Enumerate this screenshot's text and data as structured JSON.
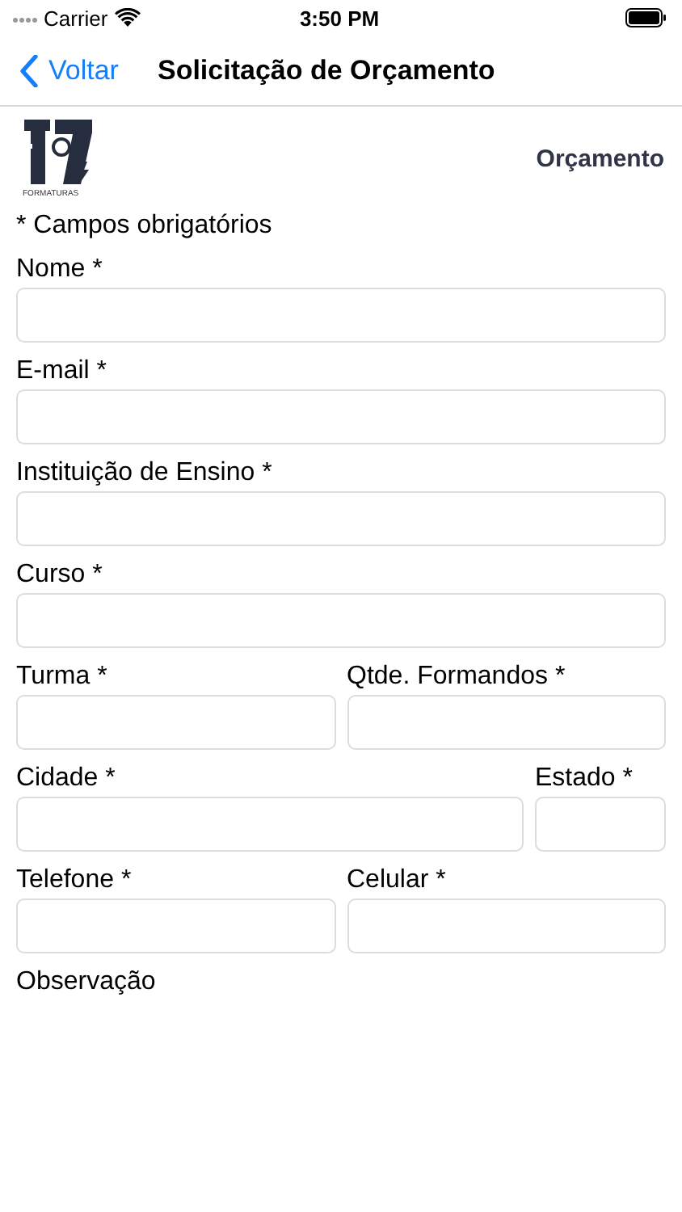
{
  "status_bar": {
    "carrier": "Carrier",
    "time": "3:50 PM"
  },
  "nav": {
    "back": "Voltar",
    "title": "Solicitação de Orçamento"
  },
  "header": {
    "logo_caption": "FORMATURAS",
    "heading": "Orçamento"
  },
  "form": {
    "note": "* Campos obrigatórios",
    "rows": [
      [
        {
          "label": "Nome *",
          "kind": "input"
        }
      ],
      [
        {
          "label": "E-mail *",
          "kind": "input"
        }
      ],
      [
        {
          "label": "Instituição de Ensino *",
          "kind": "input"
        }
      ],
      [
        {
          "label": "Curso *",
          "kind": "input"
        }
      ],
      [
        {
          "label": "Turma *",
          "kind": "input"
        },
        {
          "label": "Qtde. Formandos *",
          "kind": "input"
        }
      ],
      [
        {
          "label": "Cidade *",
          "kind": "input"
        },
        {
          "label": "Estado *",
          "kind": "short"
        }
      ],
      [
        {
          "label": "Telefone *",
          "kind": "input"
        },
        {
          "label": "Celular *",
          "kind": "input"
        }
      ],
      [
        {
          "label": "Observação",
          "kind": "label"
        }
      ]
    ]
  }
}
